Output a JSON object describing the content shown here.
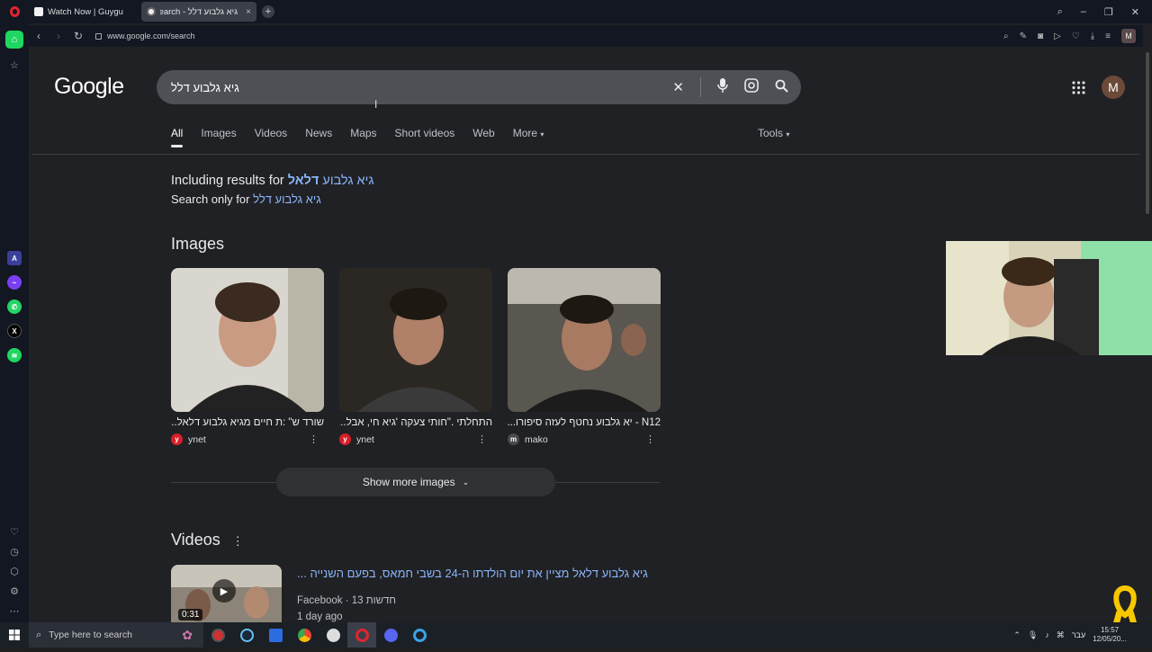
{
  "browser": {
    "tabs": [
      {
        "label": "Watch Now | Guygu",
        "active": false
      },
      {
        "label": "גיא גלבוע דלל - Google Search",
        "active": true
      }
    ],
    "url": "www.google.com/search"
  },
  "google": {
    "logo": "Google",
    "query": "גיא גלבוע דלל",
    "nav_tabs": [
      "All",
      "Images",
      "Videos",
      "News",
      "Maps",
      "Short videos",
      "Web",
      "More"
    ],
    "tools_label": "Tools",
    "avatar_letter": "M",
    "including_prefix": "Including results for",
    "including_link_a": "דלאל",
    "including_link_b": "גיא גלבוע",
    "search_only_prefix": "Search only for",
    "search_only_link": "גיא גלבוע דלל"
  },
  "images": {
    "title": "Images",
    "cards": [
      {
        "caption": "שורד ש\" :ת חיים מגיא גלבוע דלאל...",
        "source": "ynet",
        "source_color": "#d81e28",
        "source_icon": "ynet-icon"
      },
      {
        "caption": "התחלתי .\"חותי צעקה 'גיא חי, אבל...",
        "source": "ynet",
        "source_color": "#d81e28",
        "source_icon": "ynet-icon"
      },
      {
        "caption": "N12 - יא גלבוע נחטף לעזה סיפורו...",
        "source": "mako",
        "source_color": "#4a4a4a",
        "source_icon": "mako-icon"
      }
    ],
    "show_more": "Show more images"
  },
  "videos": {
    "title": "Videos",
    "items": [
      {
        "title": "גיא גלבוע דלאל מציין את יום הולדתו ה-24 בשבי חמאס, בפעם השנייה ...",
        "source": "Facebook · 13 חדשות",
        "age": "1 day ago",
        "duration": "0:31"
      }
    ]
  },
  "taskbar": {
    "search_placeholder": "Type here to search",
    "lang": "עבר",
    "time": "15:57",
    "date": "12/05/20..."
  },
  "colors": {
    "link": "#8ab4f8",
    "page_bg": "#202124",
    "searchbox_bg": "#4d5156",
    "opera_red": "#e0252f"
  }
}
